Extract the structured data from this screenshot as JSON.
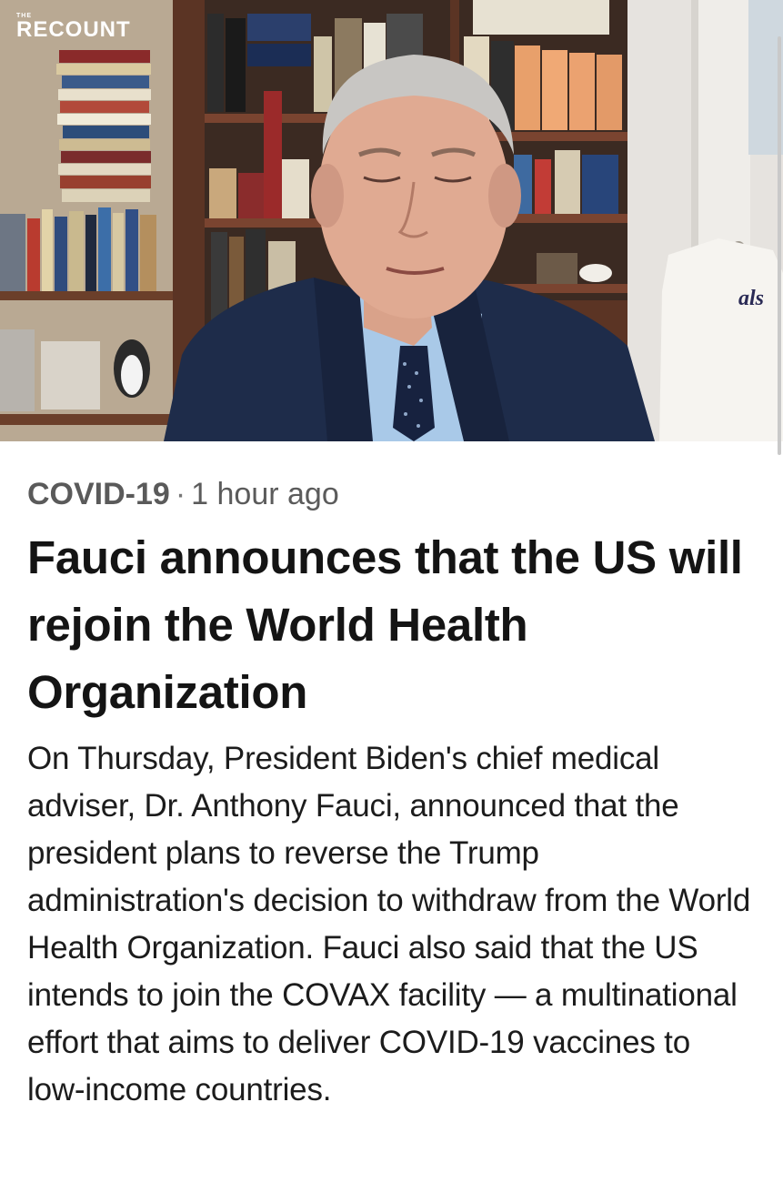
{
  "watermark": {
    "prefix": "THE",
    "brand": "RECOUNT"
  },
  "hero": {
    "description_icon": "video-thumbnail",
    "jersey_text": "als"
  },
  "article": {
    "category": "COVID-19",
    "separator": "·",
    "time_ago": "1 hour ago",
    "headline": "Fauci announces that the US will rejoin the World Health Organization",
    "summary": "On Thursday, President Biden's chief medical adviser, Dr. Anthony Fauci, announced that the president plans to reverse the Trump administration's decision to withdraw from the World Health Organization. Fauci also said that the US intends to join the COVAX facility — a multinational effort that aims to deliver COVID-19 vaccines to low-income countries."
  },
  "colors": {
    "meta": "#5b5b5b",
    "headline": "#141414",
    "body": "#1c1c1c",
    "suit": "#1e2c4a",
    "shirt": "#a9c9e8"
  }
}
